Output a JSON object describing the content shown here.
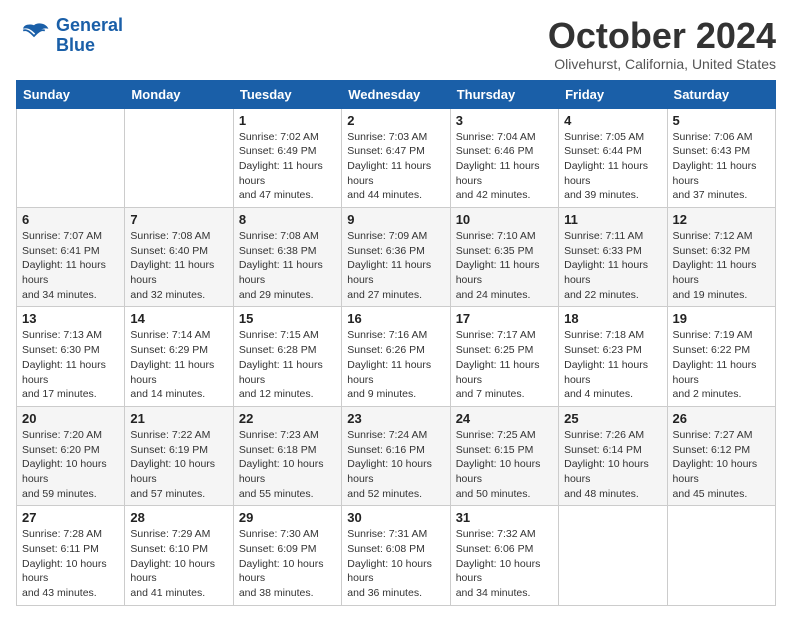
{
  "header": {
    "logo_line1": "General",
    "logo_line2": "Blue",
    "month_title": "October 2024",
    "subtitle": "Olivehurst, California, United States"
  },
  "weekdays": [
    "Sunday",
    "Monday",
    "Tuesday",
    "Wednesday",
    "Thursday",
    "Friday",
    "Saturday"
  ],
  "weeks": [
    [
      {
        "day": "",
        "detail": ""
      },
      {
        "day": "",
        "detail": ""
      },
      {
        "day": "1",
        "detail": "Sunrise: 7:02 AM\nSunset: 6:49 PM\nDaylight: 11 hours and 47 minutes."
      },
      {
        "day": "2",
        "detail": "Sunrise: 7:03 AM\nSunset: 6:47 PM\nDaylight: 11 hours and 44 minutes."
      },
      {
        "day": "3",
        "detail": "Sunrise: 7:04 AM\nSunset: 6:46 PM\nDaylight: 11 hours and 42 minutes."
      },
      {
        "day": "4",
        "detail": "Sunrise: 7:05 AM\nSunset: 6:44 PM\nDaylight: 11 hours and 39 minutes."
      },
      {
        "day": "5",
        "detail": "Sunrise: 7:06 AM\nSunset: 6:43 PM\nDaylight: 11 hours and 37 minutes."
      }
    ],
    [
      {
        "day": "6",
        "detail": "Sunrise: 7:07 AM\nSunset: 6:41 PM\nDaylight: 11 hours and 34 minutes."
      },
      {
        "day": "7",
        "detail": "Sunrise: 7:08 AM\nSunset: 6:40 PM\nDaylight: 11 hours and 32 minutes."
      },
      {
        "day": "8",
        "detail": "Sunrise: 7:08 AM\nSunset: 6:38 PM\nDaylight: 11 hours and 29 minutes."
      },
      {
        "day": "9",
        "detail": "Sunrise: 7:09 AM\nSunset: 6:36 PM\nDaylight: 11 hours and 27 minutes."
      },
      {
        "day": "10",
        "detail": "Sunrise: 7:10 AM\nSunset: 6:35 PM\nDaylight: 11 hours and 24 minutes."
      },
      {
        "day": "11",
        "detail": "Sunrise: 7:11 AM\nSunset: 6:33 PM\nDaylight: 11 hours and 22 minutes."
      },
      {
        "day": "12",
        "detail": "Sunrise: 7:12 AM\nSunset: 6:32 PM\nDaylight: 11 hours and 19 minutes."
      }
    ],
    [
      {
        "day": "13",
        "detail": "Sunrise: 7:13 AM\nSunset: 6:30 PM\nDaylight: 11 hours and 17 minutes."
      },
      {
        "day": "14",
        "detail": "Sunrise: 7:14 AM\nSunset: 6:29 PM\nDaylight: 11 hours and 14 minutes."
      },
      {
        "day": "15",
        "detail": "Sunrise: 7:15 AM\nSunset: 6:28 PM\nDaylight: 11 hours and 12 minutes."
      },
      {
        "day": "16",
        "detail": "Sunrise: 7:16 AM\nSunset: 6:26 PM\nDaylight: 11 hours and 9 minutes."
      },
      {
        "day": "17",
        "detail": "Sunrise: 7:17 AM\nSunset: 6:25 PM\nDaylight: 11 hours and 7 minutes."
      },
      {
        "day": "18",
        "detail": "Sunrise: 7:18 AM\nSunset: 6:23 PM\nDaylight: 11 hours and 4 minutes."
      },
      {
        "day": "19",
        "detail": "Sunrise: 7:19 AM\nSunset: 6:22 PM\nDaylight: 11 hours and 2 minutes."
      }
    ],
    [
      {
        "day": "20",
        "detail": "Sunrise: 7:20 AM\nSunset: 6:20 PM\nDaylight: 10 hours and 59 minutes."
      },
      {
        "day": "21",
        "detail": "Sunrise: 7:22 AM\nSunset: 6:19 PM\nDaylight: 10 hours and 57 minutes."
      },
      {
        "day": "22",
        "detail": "Sunrise: 7:23 AM\nSunset: 6:18 PM\nDaylight: 10 hours and 55 minutes."
      },
      {
        "day": "23",
        "detail": "Sunrise: 7:24 AM\nSunset: 6:16 PM\nDaylight: 10 hours and 52 minutes."
      },
      {
        "day": "24",
        "detail": "Sunrise: 7:25 AM\nSunset: 6:15 PM\nDaylight: 10 hours and 50 minutes."
      },
      {
        "day": "25",
        "detail": "Sunrise: 7:26 AM\nSunset: 6:14 PM\nDaylight: 10 hours and 48 minutes."
      },
      {
        "day": "26",
        "detail": "Sunrise: 7:27 AM\nSunset: 6:12 PM\nDaylight: 10 hours and 45 minutes."
      }
    ],
    [
      {
        "day": "27",
        "detail": "Sunrise: 7:28 AM\nSunset: 6:11 PM\nDaylight: 10 hours and 43 minutes."
      },
      {
        "day": "28",
        "detail": "Sunrise: 7:29 AM\nSunset: 6:10 PM\nDaylight: 10 hours and 41 minutes."
      },
      {
        "day": "29",
        "detail": "Sunrise: 7:30 AM\nSunset: 6:09 PM\nDaylight: 10 hours and 38 minutes."
      },
      {
        "day": "30",
        "detail": "Sunrise: 7:31 AM\nSunset: 6:08 PM\nDaylight: 10 hours and 36 minutes."
      },
      {
        "day": "31",
        "detail": "Sunrise: 7:32 AM\nSunset: 6:06 PM\nDaylight: 10 hours and 34 minutes."
      },
      {
        "day": "",
        "detail": ""
      },
      {
        "day": "",
        "detail": ""
      }
    ]
  ]
}
